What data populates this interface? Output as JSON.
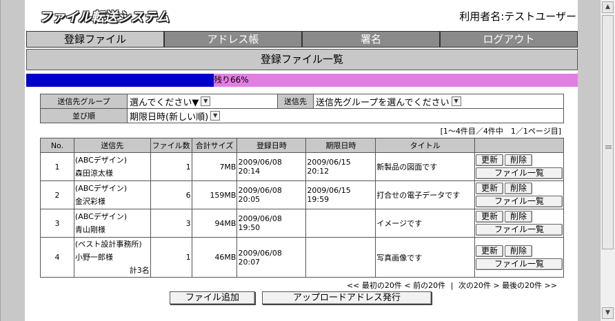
{
  "header": {
    "logo_text": "ファイル転送システム",
    "user_label": "利用者名:テストユーザー"
  },
  "tabs": [
    {
      "label": "登録ファイル",
      "active": true
    },
    {
      "label": "アドレス帳",
      "active": false
    },
    {
      "label": "署名",
      "active": false
    },
    {
      "label": "ログアウト",
      "active": false
    }
  ],
  "section_title": "登録ファイル一覧",
  "quota": {
    "remaining_label": "残り66%",
    "used_fraction": 0.34
  },
  "filters": {
    "group_label": "送信先グループ",
    "group_value": "選んでください▼",
    "dest_label": "送信先",
    "dest_value": "送信先グループを選んでください",
    "sort_label": "並び順",
    "sort_value": "期限日時(新しい順)"
  },
  "count_text": "[1～4件目／4件中　1／1ページ目]",
  "table": {
    "headers": [
      "No.",
      "送信先",
      "ファイル数",
      "合計サイズ",
      "登録日時",
      "期限日時",
      "タイトル",
      ""
    ],
    "rows": [
      {
        "no": "1",
        "company": "(ABCデザイン)",
        "name": "森田涼太様",
        "extra": "",
        "files": "1",
        "size": "7MB",
        "registered": "2009/06/08 20:14",
        "expires": "2009/06/15 20:12",
        "title": "新製品の図面です"
      },
      {
        "no": "2",
        "company": "(ABCデザイン)",
        "name": "金沢彩様",
        "extra": "",
        "files": "6",
        "size": "159MB",
        "registered": "2009/06/08 20:05",
        "expires": "2009/06/15 19:59",
        "title": "打合せの電子データです"
      },
      {
        "no": "3",
        "company": "(ABCデザイン)",
        "name": "青山剛様",
        "extra": "",
        "files": "3",
        "size": "94MB",
        "registered": "2009/06/08 19:50",
        "expires": "",
        "title": "イメージです"
      },
      {
        "no": "4",
        "company": "(ベスト設計事務所)",
        "name": "小野一郎様",
        "extra": "計3名",
        "files": "1",
        "size": "46MB",
        "registered": "2009/06/08 20:07",
        "expires": "",
        "title": "写真画像です"
      }
    ],
    "update_label": "更新",
    "delete_label": "削除",
    "filelist_label": "ファイル一覧"
  },
  "pager": {
    "first": "<< 最初の20件",
    "prev": "< 前の20件",
    "sep": "|",
    "next": "次の20件 >",
    "last": "最後の20件 >>"
  },
  "actions": {
    "add_file": "ファイル追加",
    "issue_upload": "アップロードアドレス発行"
  }
}
